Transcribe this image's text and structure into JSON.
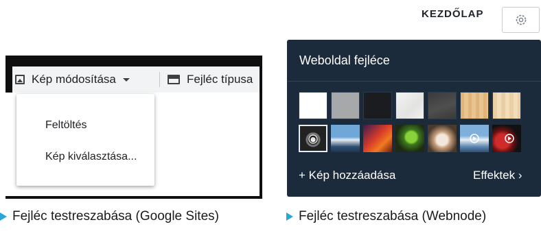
{
  "google_sites": {
    "change_image_label": "Kép módosítása",
    "header_type_label": "Fejléc típusa",
    "menu": [
      {
        "label": "Feltöltés"
      },
      {
        "label": "Kép kiválasztása..."
      }
    ],
    "caption": "Fejléc testreszabása (Google Sites)"
  },
  "webnode": {
    "nav_home": "KEZDŐLAP",
    "panel_title": "Weboldal fejléce",
    "add_image": "+ Kép hozzáadása",
    "effects": "Effektek ›",
    "caption": "Fejléc testreszabása (Webnode)",
    "colors": [
      "#ffffff",
      "#a6a8aa",
      "#1a1c1f",
      "#efefee",
      "#454545",
      "#e3bd86",
      "#edd3ad"
    ],
    "accent": "#2aa7d6"
  }
}
